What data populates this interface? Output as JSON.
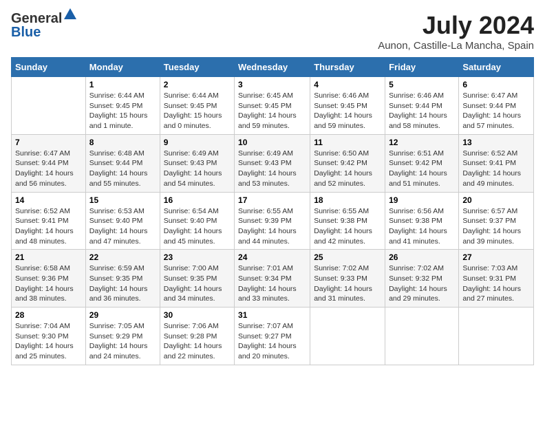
{
  "logo": {
    "general": "General",
    "blue": "Blue"
  },
  "title": "July 2024",
  "subtitle": "Aunon, Castille-La Mancha, Spain",
  "headers": [
    "Sunday",
    "Monday",
    "Tuesday",
    "Wednesday",
    "Thursday",
    "Friday",
    "Saturday"
  ],
  "weeks": [
    [
      {
        "day": "",
        "info": ""
      },
      {
        "day": "1",
        "info": "Sunrise: 6:44 AM\nSunset: 9:45 PM\nDaylight: 15 hours\nand 1 minute."
      },
      {
        "day": "2",
        "info": "Sunrise: 6:44 AM\nSunset: 9:45 PM\nDaylight: 15 hours\nand 0 minutes."
      },
      {
        "day": "3",
        "info": "Sunrise: 6:45 AM\nSunset: 9:45 PM\nDaylight: 14 hours\nand 59 minutes."
      },
      {
        "day": "4",
        "info": "Sunrise: 6:46 AM\nSunset: 9:45 PM\nDaylight: 14 hours\nand 59 minutes."
      },
      {
        "day": "5",
        "info": "Sunrise: 6:46 AM\nSunset: 9:44 PM\nDaylight: 14 hours\nand 58 minutes."
      },
      {
        "day": "6",
        "info": "Sunrise: 6:47 AM\nSunset: 9:44 PM\nDaylight: 14 hours\nand 57 minutes."
      }
    ],
    [
      {
        "day": "7",
        "info": "Sunrise: 6:47 AM\nSunset: 9:44 PM\nDaylight: 14 hours\nand 56 minutes."
      },
      {
        "day": "8",
        "info": "Sunrise: 6:48 AM\nSunset: 9:44 PM\nDaylight: 14 hours\nand 55 minutes."
      },
      {
        "day": "9",
        "info": "Sunrise: 6:49 AM\nSunset: 9:43 PM\nDaylight: 14 hours\nand 54 minutes."
      },
      {
        "day": "10",
        "info": "Sunrise: 6:49 AM\nSunset: 9:43 PM\nDaylight: 14 hours\nand 53 minutes."
      },
      {
        "day": "11",
        "info": "Sunrise: 6:50 AM\nSunset: 9:42 PM\nDaylight: 14 hours\nand 52 minutes."
      },
      {
        "day": "12",
        "info": "Sunrise: 6:51 AM\nSunset: 9:42 PM\nDaylight: 14 hours\nand 51 minutes."
      },
      {
        "day": "13",
        "info": "Sunrise: 6:52 AM\nSunset: 9:41 PM\nDaylight: 14 hours\nand 49 minutes."
      }
    ],
    [
      {
        "day": "14",
        "info": "Sunrise: 6:52 AM\nSunset: 9:41 PM\nDaylight: 14 hours\nand 48 minutes."
      },
      {
        "day": "15",
        "info": "Sunrise: 6:53 AM\nSunset: 9:40 PM\nDaylight: 14 hours\nand 47 minutes."
      },
      {
        "day": "16",
        "info": "Sunrise: 6:54 AM\nSunset: 9:40 PM\nDaylight: 14 hours\nand 45 minutes."
      },
      {
        "day": "17",
        "info": "Sunrise: 6:55 AM\nSunset: 9:39 PM\nDaylight: 14 hours\nand 44 minutes."
      },
      {
        "day": "18",
        "info": "Sunrise: 6:55 AM\nSunset: 9:38 PM\nDaylight: 14 hours\nand 42 minutes."
      },
      {
        "day": "19",
        "info": "Sunrise: 6:56 AM\nSunset: 9:38 PM\nDaylight: 14 hours\nand 41 minutes."
      },
      {
        "day": "20",
        "info": "Sunrise: 6:57 AM\nSunset: 9:37 PM\nDaylight: 14 hours\nand 39 minutes."
      }
    ],
    [
      {
        "day": "21",
        "info": "Sunrise: 6:58 AM\nSunset: 9:36 PM\nDaylight: 14 hours\nand 38 minutes."
      },
      {
        "day": "22",
        "info": "Sunrise: 6:59 AM\nSunset: 9:35 PM\nDaylight: 14 hours\nand 36 minutes."
      },
      {
        "day": "23",
        "info": "Sunrise: 7:00 AM\nSunset: 9:35 PM\nDaylight: 14 hours\nand 34 minutes."
      },
      {
        "day": "24",
        "info": "Sunrise: 7:01 AM\nSunset: 9:34 PM\nDaylight: 14 hours\nand 33 minutes."
      },
      {
        "day": "25",
        "info": "Sunrise: 7:02 AM\nSunset: 9:33 PM\nDaylight: 14 hours\nand 31 minutes."
      },
      {
        "day": "26",
        "info": "Sunrise: 7:02 AM\nSunset: 9:32 PM\nDaylight: 14 hours\nand 29 minutes."
      },
      {
        "day": "27",
        "info": "Sunrise: 7:03 AM\nSunset: 9:31 PM\nDaylight: 14 hours\nand 27 minutes."
      }
    ],
    [
      {
        "day": "28",
        "info": "Sunrise: 7:04 AM\nSunset: 9:30 PM\nDaylight: 14 hours\nand 25 minutes."
      },
      {
        "day": "29",
        "info": "Sunrise: 7:05 AM\nSunset: 9:29 PM\nDaylight: 14 hours\nand 24 minutes."
      },
      {
        "day": "30",
        "info": "Sunrise: 7:06 AM\nSunset: 9:28 PM\nDaylight: 14 hours\nand 22 minutes."
      },
      {
        "day": "31",
        "info": "Sunrise: 7:07 AM\nSunset: 9:27 PM\nDaylight: 14 hours\nand 20 minutes."
      },
      {
        "day": "",
        "info": ""
      },
      {
        "day": "",
        "info": ""
      },
      {
        "day": "",
        "info": ""
      }
    ]
  ]
}
